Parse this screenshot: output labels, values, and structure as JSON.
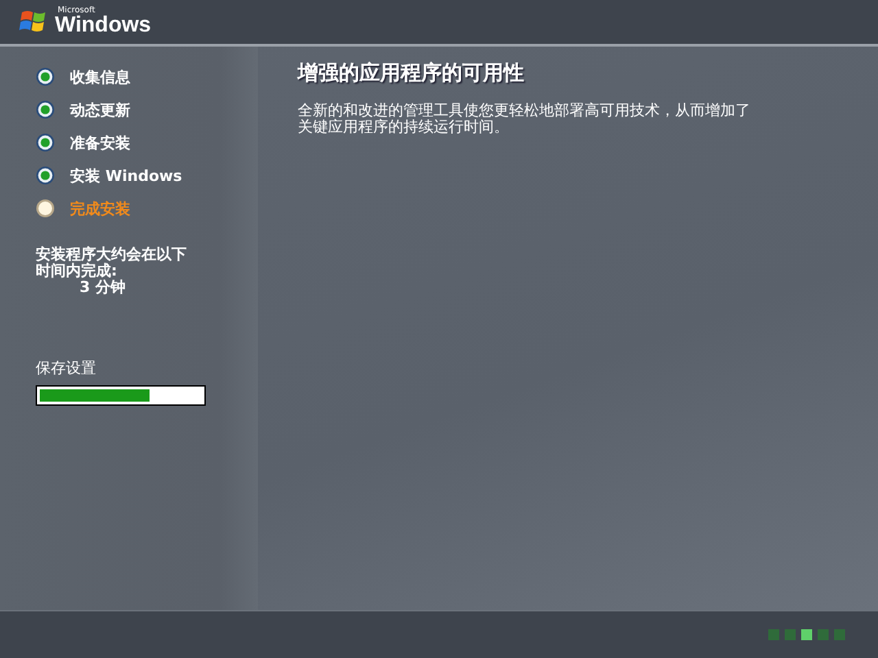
{
  "logo": {
    "small": "Microsoft",
    "name": "Windows"
  },
  "steps": [
    {
      "label": "收集信息",
      "kind": "done"
    },
    {
      "label": "动态更新",
      "kind": "done"
    },
    {
      "label": "准备安装",
      "kind": "done"
    },
    {
      "label": "安装 Windows",
      "kind": "done"
    },
    {
      "label": "完成安装",
      "kind": "current"
    }
  ],
  "estimate": {
    "text": "安装程序大约会在以下时间内完成:",
    "time": "3 分钟"
  },
  "task": {
    "label": "保存设置",
    "level": 0.68
  },
  "content": {
    "title": "增强的应用程序的可用性",
    "body": "全新的和改进的管理工具使您更轻松地部署高可用技术，从而增加了关键应用程序的持续运行时间。"
  },
  "activity_dots": [
    {
      "selected": false
    },
    {
      "selected": false
    },
    {
      "selected": true
    },
    {
      "selected": false
    },
    {
      "selected": false
    }
  ]
}
